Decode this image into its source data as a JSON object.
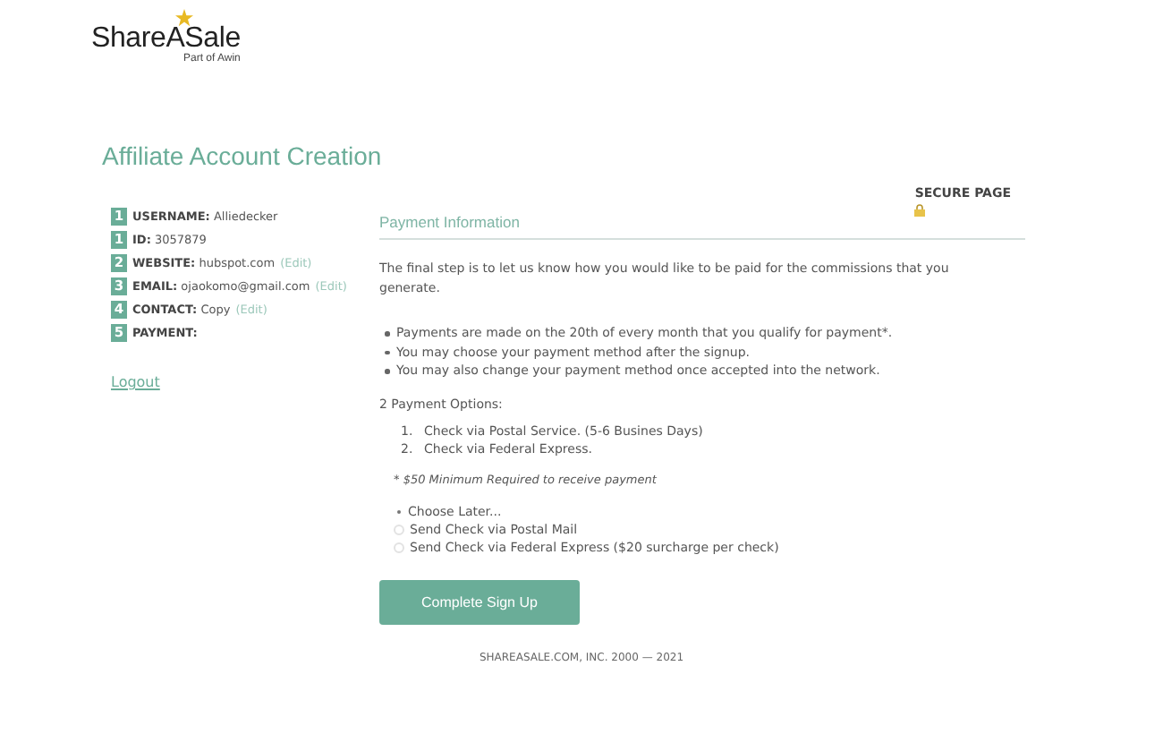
{
  "logo": {
    "name": "ShareASale",
    "tagline": "Part of Awin"
  },
  "title": "Affiliate Account Creation",
  "steps": [
    {
      "number": "1",
      "label": "USERNAME:",
      "value": "Alliedecker"
    },
    {
      "number": "1",
      "label": "ID:",
      "value": "3057879"
    },
    {
      "number": "2",
      "label": "WEBSITE:",
      "value": "hubspot.com",
      "edit": "(Edit)"
    },
    {
      "number": "3",
      "label": "EMAIL:",
      "value": "ojaokomo@gmail.com",
      "edit": "(Edit)"
    },
    {
      "number": "4",
      "label": "CONTACT:",
      "value": "Copy",
      "edit": "(Edit)"
    },
    {
      "number": "5",
      "label": "PAYMENT:"
    }
  ],
  "logout": "Logout",
  "secure_page": "SECURE PAGE",
  "payment": {
    "heading": "Payment Information",
    "intro": "The final step is to let us know how you would like to be paid for the commissions that you generate.",
    "bullets": [
      "Payments are made on the 20th of every month that you qualify for payment*.",
      "You may choose your payment method after the signup.",
      "You may also change your payment method once accepted into the network."
    ],
    "options_heading": "2 Payment Options:",
    "options": [
      {
        "number": "1.",
        "text": "Check via Postal Service. (5-6 Busines Days)"
      },
      {
        "number": "2.",
        "text": "Check via Federal Express."
      }
    ],
    "note": "* $50 Minimum Required to receive payment",
    "choices": [
      {
        "label": "Choose Later...",
        "selected": true
      },
      {
        "label": "Send Check via Postal Mail",
        "selected": false
      },
      {
        "label": "Send Check via Federal Express ($20 surcharge per check)",
        "selected": false
      }
    ],
    "button": "Complete Sign Up"
  },
  "footer": "SHAREASALE.COM, INC. 2000 — 2021"
}
